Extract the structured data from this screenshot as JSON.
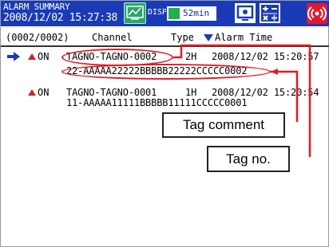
{
  "status_bar": {
    "title": "ALARM SUMMARY",
    "datetime": "2008/12/02 15:27:38",
    "disp_label": "DISP",
    "interval": "52min",
    "icons": [
      "display-icon",
      "monitor-icon",
      "math-icon",
      "alarm-icon"
    ],
    "colors": {
      "bar": "#1a3bb5",
      "disp": "#2aa66a",
      "interval_fill": "#21b04b",
      "alarm": "#e0192c"
    }
  },
  "header": {
    "count": "(0002/0002)",
    "channel": "Channel",
    "type": "Type",
    "alarm_time": "Alarm Time",
    "sort_icon": "sort-down-triangle-icon"
  },
  "entries": [
    {
      "state": "ON",
      "tag": "TAGNO-TAGNO-0002",
      "type": "2H",
      "time": "2008/12/02 15:20:57",
      "comment": "22-AAAAA22222BBBBB22222CCCCC0002"
    },
    {
      "state": "ON",
      "tag": "TAGNO-TAGNO-0001",
      "type": "1H",
      "time": "2008/12/02 15:20:54",
      "comment": "11-AAAAA11111BBBBB11111CCCCC0001"
    }
  ],
  "annotations": {
    "tag_comment": "Tag comment",
    "tag_no": "Tag no.",
    "color": "#e01b24"
  }
}
